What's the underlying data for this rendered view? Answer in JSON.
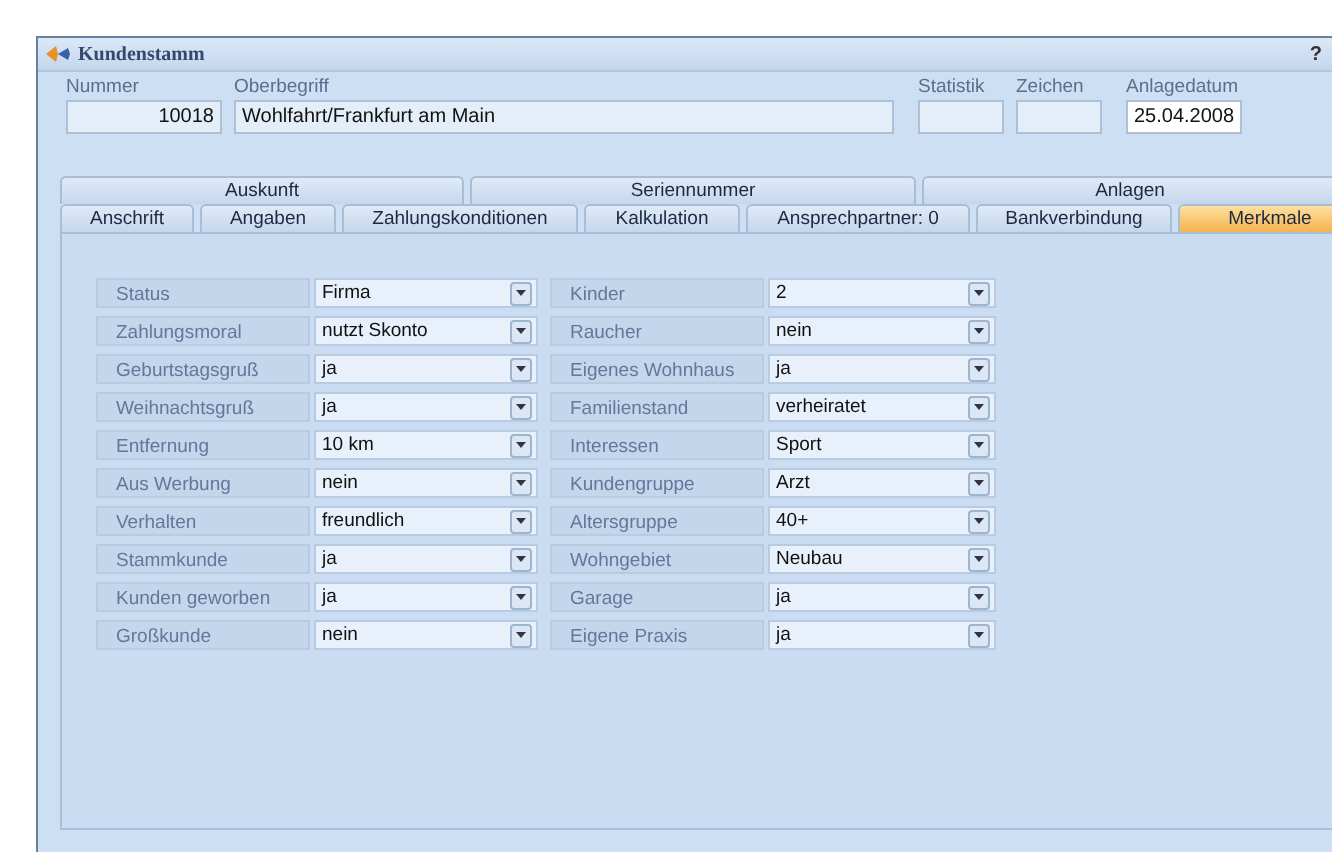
{
  "window": {
    "title": "Kundenstamm",
    "help": "?"
  },
  "header_fields": [
    {
      "kind": "number",
      "label": "Nummer",
      "value": "10018"
    },
    {
      "kind": "text",
      "label": "Oberbegriff",
      "value": "Wohlfahrt/Frankfurt am Main"
    },
    {
      "kind": "small",
      "label": "Statistik"
    },
    {
      "kind": "small",
      "label": "Zeichen"
    },
    {
      "kind": "date",
      "label": "Anlagedatum",
      "value": "25.04.2008"
    }
  ],
  "tabs_top": [
    {
      "label": "Auskunft",
      "selected": false
    },
    {
      "label": "Seriennummer",
      "selected": false
    },
    {
      "label": "Anlagen",
      "selected": false
    }
  ],
  "tabs": [
    {
      "label": "Anschrift",
      "selected": false
    },
    {
      "label": "Angaben",
      "selected": false
    },
    {
      "label": "Zahlungskonditionen",
      "selected": false
    },
    {
      "label": "Kalkulation",
      "selected": false
    },
    {
      "label": "Ansprechpartner: 0",
      "selected": false
    },
    {
      "label": "Bankverbindung",
      "selected": false
    },
    {
      "label": "Merkmale",
      "selected": true
    }
  ],
  "attributes_left": [
    {
      "label": "Status",
      "value": "Firma"
    },
    {
      "label": "Zahlungsmoral",
      "value": "nutzt Skonto"
    },
    {
      "label": "Geburtstagsgruß",
      "value": "ja"
    },
    {
      "label": "Weihnachtsgruß",
      "value": "ja"
    },
    {
      "label": "Entfernung",
      "value": "10 km"
    },
    {
      "label": "Aus Werbung",
      "value": "nein"
    },
    {
      "label": "Verhalten",
      "value": "freundlich"
    },
    {
      "label": "Stammkunde",
      "value": "ja"
    },
    {
      "label": "Kunden geworben",
      "value": "ja"
    },
    {
      "label": "Großkunde",
      "value": "nein"
    }
  ],
  "attributes_right": [
    {
      "label": "Kinder",
      "value": "2"
    },
    {
      "label": "Raucher",
      "value": "nein"
    },
    {
      "label": "Eigenes Wohnhaus",
      "value": "ja"
    },
    {
      "label": "Familienstand",
      "value": "verheiratet"
    },
    {
      "label": "Interessen",
      "value": "Sport"
    },
    {
      "label": "Kundengruppe",
      "value": "Arzt"
    },
    {
      "label": "Altersgruppe",
      "value": "40+"
    },
    {
      "label": "Wohngebiet",
      "value": "Neubau"
    },
    {
      "label": "Garage",
      "value": "ja"
    },
    {
      "label": "Eigene Praxis",
      "value": "ja"
    }
  ]
}
